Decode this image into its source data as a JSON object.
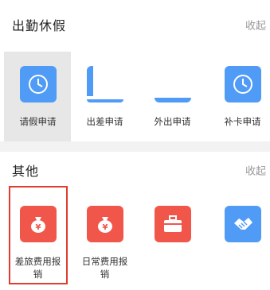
{
  "attendance": {
    "title": "出勤休假",
    "collapse": "收起",
    "items": [
      {
        "label": "请假申请",
        "icon": "clock-icon"
      },
      {
        "label": "出差申请",
        "icon": "partial-blue-icon"
      },
      {
        "label": "外出申请",
        "icon": "partial-blue-icon"
      },
      {
        "label": "补卡申请",
        "icon": "clock-icon"
      }
    ]
  },
  "other": {
    "title": "其他",
    "collapse": "收起",
    "items": [
      {
        "label_line1": "差旅费用报",
        "label_line2": "销",
        "icon": "money-bag-icon"
      },
      {
        "label_line1": "日常费用报",
        "label_line2": "销",
        "icon": "money-bag-icon"
      },
      {
        "label_line1": "",
        "label_line2": "",
        "icon": "briefcase-icon"
      },
      {
        "label_line1": "",
        "label_line2": "",
        "icon": "handshake-icon"
      }
    ]
  },
  "colors": {
    "tile_blue": "#4f9bf5",
    "tile_red": "#f0574a",
    "highlight_border": "#e03c2f"
  }
}
